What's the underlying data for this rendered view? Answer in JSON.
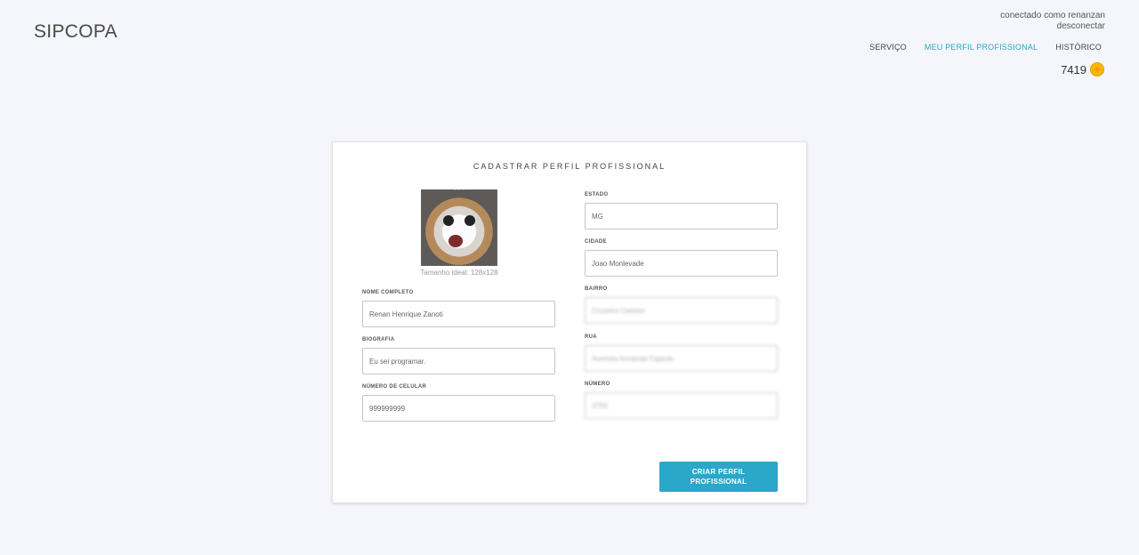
{
  "app": {
    "title": "SIPCOPA"
  },
  "user": {
    "connected_label": "conectado como renanzan",
    "logout_label": "desconectar"
  },
  "nav": {
    "items": [
      {
        "label": "SERVIÇO",
        "active": false
      },
      {
        "label": "MEU PERFIL PROFISSIONAL",
        "active": true
      },
      {
        "label": "HISTÓRICO",
        "active": false
      }
    ]
  },
  "coins": {
    "value": "7419",
    "icon": "coin-plus-icon"
  },
  "form": {
    "title": "CADASTRAR PERFIL PROFISSIONAL",
    "avatar_hint": "Tamanho ideal: 128x128",
    "fields_left": [
      {
        "label": "NOME COMPLETO",
        "value": "Renan Henrique Zanoti"
      },
      {
        "label": "BIOGRAFIA",
        "value": "Eu sei programar."
      },
      {
        "label": "NÚMERO DE CELULAR",
        "value": "999999999"
      }
    ],
    "fields_right": [
      {
        "label": "ESTADO",
        "value": "MG"
      },
      {
        "label": "CIDADE",
        "value": "Joao Monlevade"
      },
      {
        "label": "BAIRRO",
        "value": "Cruzeiro Celeste"
      },
      {
        "label": "RUA",
        "value": "Avenida Armando Fajardo"
      },
      {
        "label": "NÚMERO",
        "value": "3755"
      }
    ],
    "submit_label": "CRIAR PERFIL PROFISSIONAL"
  },
  "colors": {
    "accent": "#2aa7c9",
    "background": "#f5f6fb",
    "coin": "#f5b800"
  }
}
